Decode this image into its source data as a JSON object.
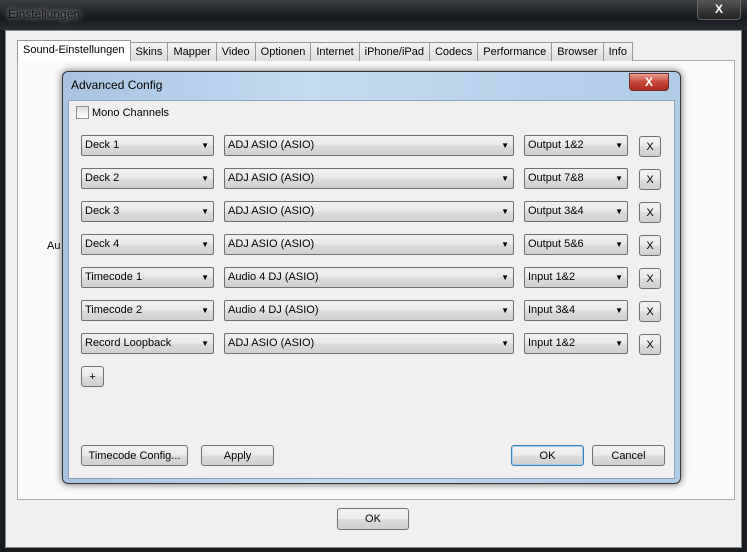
{
  "window": {
    "title": "Einstellungen",
    "close_label": "X",
    "ok_label": "OK"
  },
  "tabs": [
    "Sound-Einstellungen",
    "Skins",
    "Mapper",
    "Video",
    "Optionen",
    "Internet",
    "iPhone/iPad",
    "Codecs",
    "Performance",
    "Browser",
    "Info"
  ],
  "background_label": "Au",
  "dialog": {
    "title": "Advanced Config",
    "close_label": "X",
    "mono_label": "Mono Channels",
    "rows": [
      {
        "channel": "Deck 1",
        "device": "ADJ ASIO (ASIO)",
        "output": "Output 1&2"
      },
      {
        "channel": "Deck 2",
        "device": "ADJ ASIO (ASIO)",
        "output": "Output 7&8"
      },
      {
        "channel": "Deck 3",
        "device": "ADJ ASIO (ASIO)",
        "output": "Output 3&4"
      },
      {
        "channel": "Deck 4",
        "device": "ADJ ASIO (ASIO)",
        "output": "Output 5&6"
      },
      {
        "channel": "Timecode 1",
        "device": "Audio 4 DJ (ASIO)",
        "output": "Input 1&2"
      },
      {
        "channel": "Timecode 2",
        "device": "Audio 4 DJ (ASIO)",
        "output": "Input 3&4"
      },
      {
        "channel": "Record Loopback",
        "device": "ADJ ASIO (ASIO)",
        "output": "Input 1&2"
      }
    ],
    "remove_label": "X",
    "add_label": "+",
    "timecode_config_label": "Timecode Config...",
    "apply_label": "Apply",
    "ok_label": "OK",
    "cancel_label": "Cancel"
  }
}
